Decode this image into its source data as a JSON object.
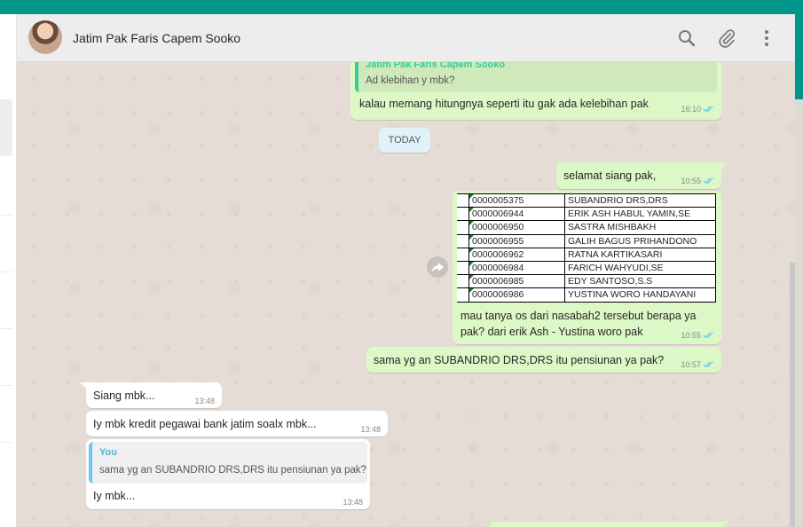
{
  "header": {
    "contact_name": "Jatim Pak Faris Capem Sooko",
    "icons": [
      "search-icon",
      "paperclip-icon",
      "menu-icon"
    ]
  },
  "divider": {
    "label": "TODAY"
  },
  "colors": {
    "teal": "#00968a",
    "outgoing": "#dcf8c6",
    "incoming": "#ffffff",
    "tick": "#4fc3f7"
  },
  "messages": {
    "m1": {
      "quote_name": "Jatim Pak Faris Capem Sooko",
      "quote_text": "Ad klebihan y mbk?",
      "text": "kalau memang hitungnya seperti itu gak ada kelebihan pak",
      "time": "16:10"
    },
    "m2": {
      "text": "selamat siang pak,",
      "time": "10:55"
    },
    "m3": {
      "table": [
        [
          "0000005375",
          "SUBANDRIO DRS,DRS"
        ],
        [
          "0000006944",
          "ERIK ASH HABUL YAMIN,SE"
        ],
        [
          "0000006950",
          "SASTRA MISHBAKH"
        ],
        [
          "0000006955",
          "GALIH BAGUS PRIHANDONO"
        ],
        [
          "0000006962",
          "RATNA KARTIKASARI"
        ],
        [
          "0000006984",
          "FARICH WAHYUDI,SE"
        ],
        [
          "0000006985",
          "EDY SANTOSO,S.S"
        ],
        [
          "0000006986",
          "YUSTINA WORO HANDAYANI"
        ]
      ],
      "caption_line1": "mau tanya os dari nasabah2 tersebut berapa ya",
      "caption_line2": "pak? dari erik Ash - Yustina woro pak",
      "time": "10:55"
    },
    "m4": {
      "text": "sama yg an SUBANDRIO DRS,DRS itu pensiunan ya pak?",
      "time": "10:57"
    },
    "m5": {
      "text": "Siang mbk...",
      "time": "13:48"
    },
    "m6": {
      "text": "Iy mbk kredit pegawai bank jatim soalx mbk...",
      "time": "13:48"
    },
    "m7": {
      "quote_name": "You",
      "quote_text": "sama yg an SUBANDRIO DRS,DRS itu pensiunan ya pak?",
      "text": "Iy mbk...",
      "time": "13:48"
    }
  }
}
